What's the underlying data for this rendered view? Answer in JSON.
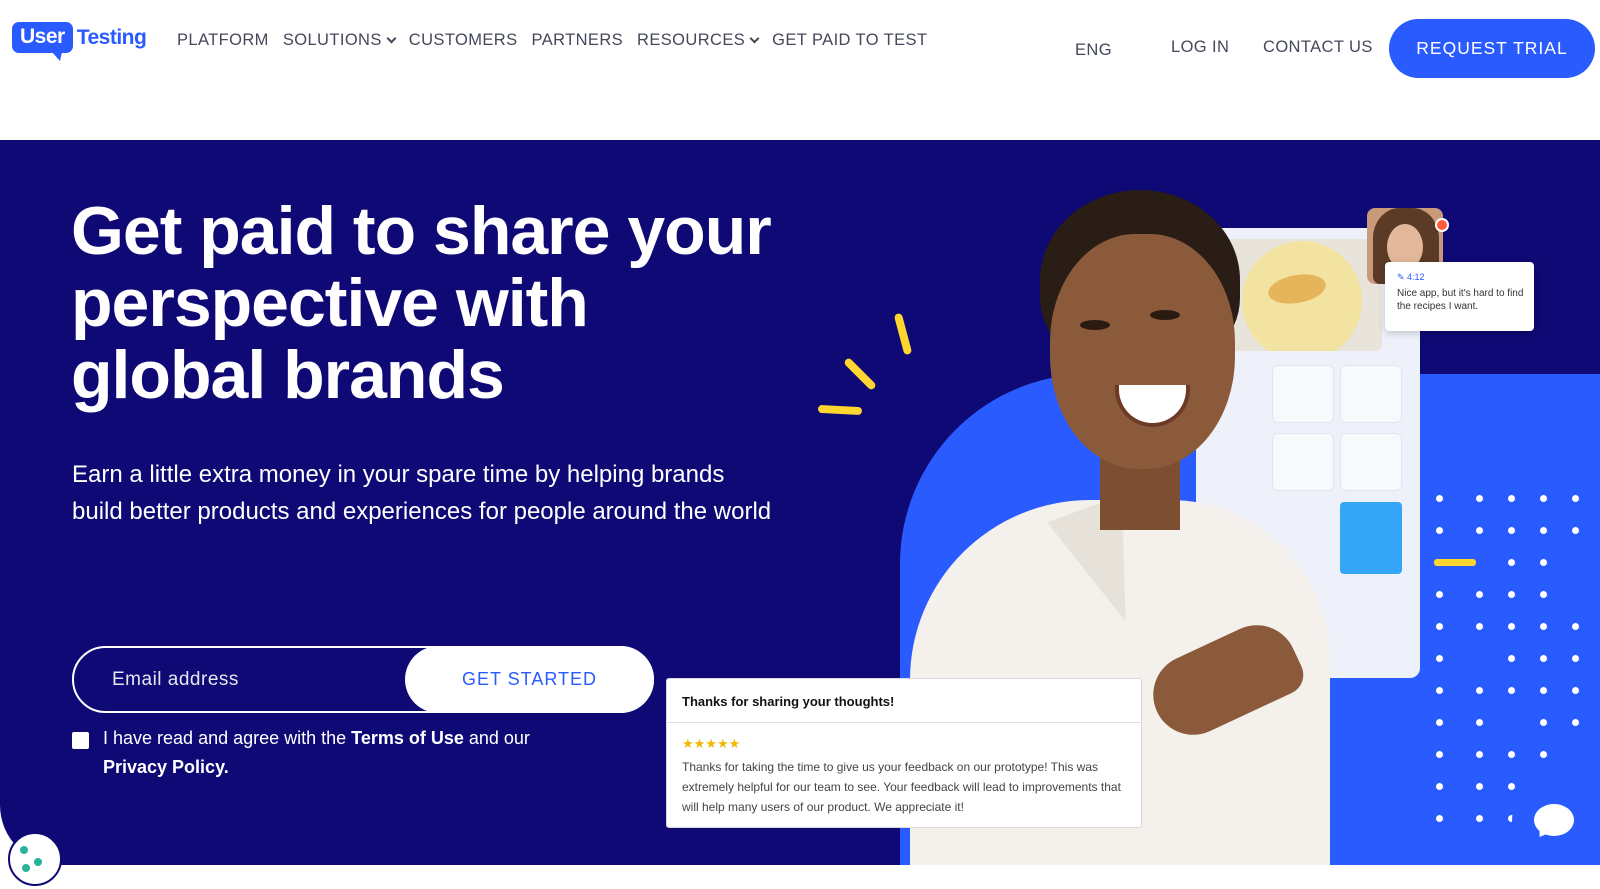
{
  "header": {
    "logo": {
      "box_text": "User",
      "text": "Testing"
    },
    "nav": [
      {
        "label": "PLATFORM",
        "dropdown": false
      },
      {
        "label": "SOLUTIONS",
        "dropdown": true
      },
      {
        "label": "CUSTOMERS",
        "dropdown": false
      },
      {
        "label": "PARTNERS",
        "dropdown": false
      },
      {
        "label": "RESOURCES",
        "dropdown": true
      },
      {
        "label": "GET PAID TO TEST",
        "dropdown": false
      }
    ],
    "language": "ENG",
    "login": "LOG IN",
    "contact": "CONTACT US",
    "trial_button": "REQUEST TRIAL"
  },
  "hero": {
    "headline": "Get paid to share your perspective with global brands",
    "subtext": "Earn a little extra money in your spare time by helping brands build better products and experiences for people around the world",
    "email_placeholder": "Email address",
    "get_started": "GET STARTED",
    "agree_prefix": "I have read and agree with the ",
    "terms_link": "Terms of Use",
    "agree_middle": " and our ",
    "privacy_link": "Privacy Policy."
  },
  "illustration": {
    "note_time": "4:12",
    "note_text": "Nice app, but it's hard to find the recipes I want.",
    "feedback_title": "Thanks for sharing your thoughts!",
    "feedback_stars": "★★★★★",
    "feedback_body": "Thanks for taking the time to give us your feedback on our prototype! This was extremely helpful for our team to see. Your feedback will lead to improvements that will help many users of our product. We appreciate it!"
  },
  "colors": {
    "brand_blue": "#2a5bff",
    "hero_navy": "#0e0975",
    "accent_yellow": "#ffd630"
  },
  "icons": [
    "chevron-down-icon",
    "edit-icon",
    "chat-icon",
    "cookie-icon",
    "star-icon"
  ]
}
